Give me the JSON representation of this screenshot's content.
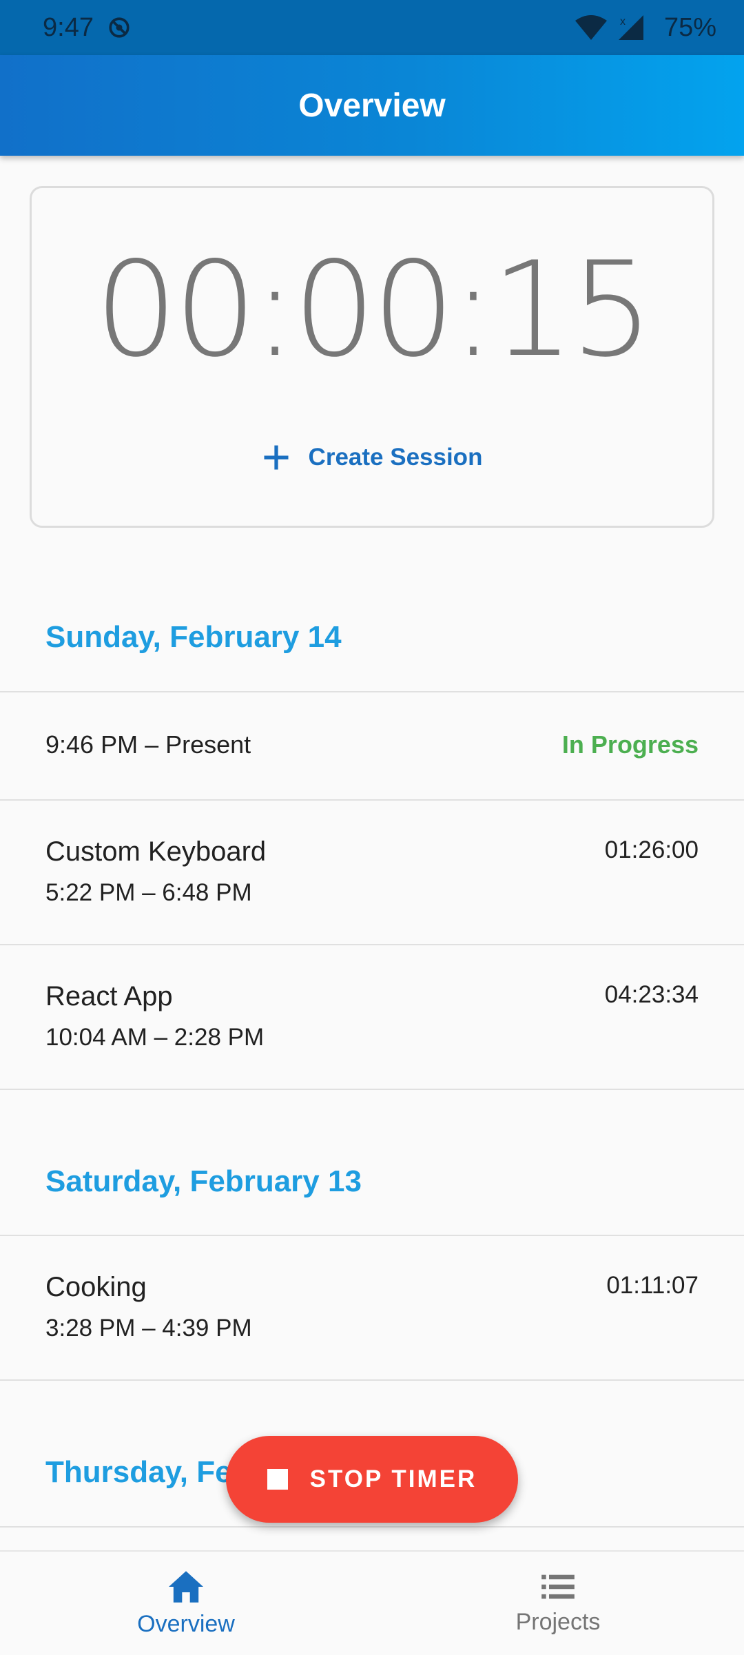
{
  "status_bar": {
    "time": "9:47",
    "battery": "75%"
  },
  "app_bar": {
    "title": "Overview"
  },
  "timer": {
    "display": "00:00:15",
    "create_session_label": "Create Session"
  },
  "sections": [
    {
      "header": "Sunday, February 14",
      "rows": [
        {
          "title": "",
          "time_range": "9:46 PM – Present",
          "right": "In Progress"
        },
        {
          "title": "Custom Keyboard",
          "time_range": "5:22 PM – 6:48 PM",
          "right": "01:26:00"
        },
        {
          "title": "React App",
          "time_range": "10:04 AM – 2:28 PM",
          "right": "04:23:34"
        }
      ]
    },
    {
      "header": "Saturday, February 13",
      "rows": [
        {
          "title": "Cooking",
          "time_range": "3:28 PM – 4:39 PM",
          "right": "01:11:07"
        }
      ]
    },
    {
      "header": "Thursday, Fe"
    }
  ],
  "fab": {
    "label": "STOP TIMER"
  },
  "bottom_nav": [
    {
      "label": "Overview",
      "icon": "home-icon",
      "active": true
    },
    {
      "label": "Projects",
      "icon": "list-icon",
      "active": false
    }
  ],
  "colors": {
    "accent": "#1a6fc0",
    "section_header": "#1e9de0",
    "in_progress": "#4caf50",
    "fab": "#f44336"
  }
}
